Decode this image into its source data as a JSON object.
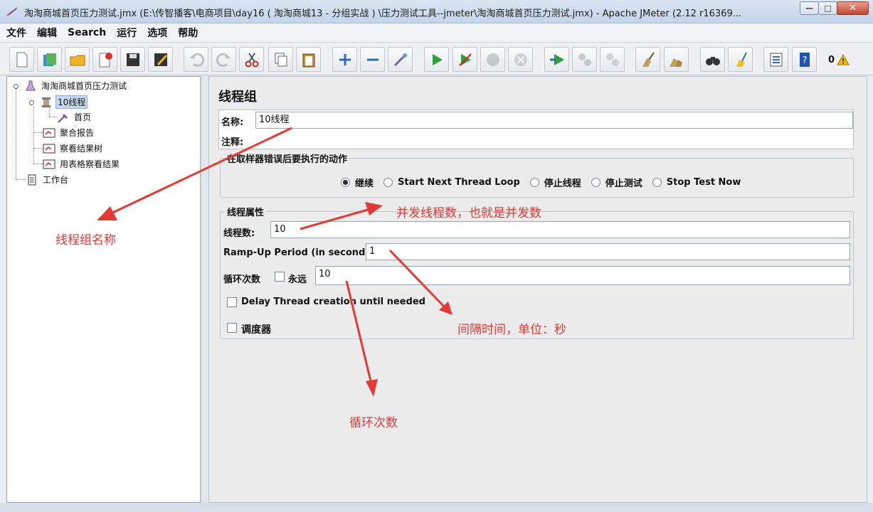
{
  "window": {
    "title": "淘淘商城首页压力测试.jmx (E:\\传智播客\\电商项目\\day16 ( 淘淘商城13 - 分组实战 ) \\压力测试工具--jmeter\\淘淘商城首页压力测试.jmx) - Apache JMeter (2.12 r16369...",
    "minimize": "—",
    "maximize": "□",
    "close": "✕"
  },
  "menu": [
    "文件",
    "编辑",
    "Search",
    "运行",
    "选项",
    "帮助"
  ],
  "toolbar": {
    "warning_count": "0",
    "buttons": [
      "new",
      "templates",
      "open",
      "close",
      "save",
      "save-as",
      "undo",
      "redo",
      "cut",
      "copy",
      "paste",
      "expand",
      "collapse",
      "toggle",
      "start",
      "start-no-pauses",
      "stop",
      "shutdown",
      "remote-start",
      "remote-stop",
      "remote-shutdown",
      "clear",
      "clear-all",
      "search",
      "reset-search",
      "function-helper",
      "help"
    ]
  },
  "tree": {
    "root": "淘淘商城首页压力测试",
    "thread_group": "10线程",
    "sampler": "首页",
    "listeners": [
      "聚合报告",
      "察看结果树",
      "用表格察看结果"
    ],
    "workbench": "工作台"
  },
  "form": {
    "panel_title": "线程组",
    "name_label": "名称:",
    "name_value": "10线程",
    "comment_label": "注释:",
    "comment_value": "",
    "error_action_legend": "在取样器错误后要执行的动作",
    "error_actions": [
      "继续",
      "Start Next Thread Loop",
      "停止线程",
      "停止测试",
      "Stop Test Now"
    ],
    "error_action_selected": 0,
    "thread_props_legend": "线程属性",
    "threads_label": "线程数:",
    "threads_value": "10",
    "rampup_label": "Ramp-Up Period (in seconds):",
    "rampup_value": "1",
    "loop_label": "循环次数",
    "forever_label": "永远",
    "forever_checked": false,
    "loop_value": "10",
    "delay_label": "Delay Thread creation until needed",
    "delay_checked": false,
    "scheduler_label": "调度器",
    "scheduler_checked": false
  },
  "annotations": {
    "group_name": "线程组名称",
    "threads": "并发线程数，也就是并发数",
    "rampup": "间隔时间，单位：秒",
    "loops": "循环次数",
    "color": "#e53935"
  }
}
